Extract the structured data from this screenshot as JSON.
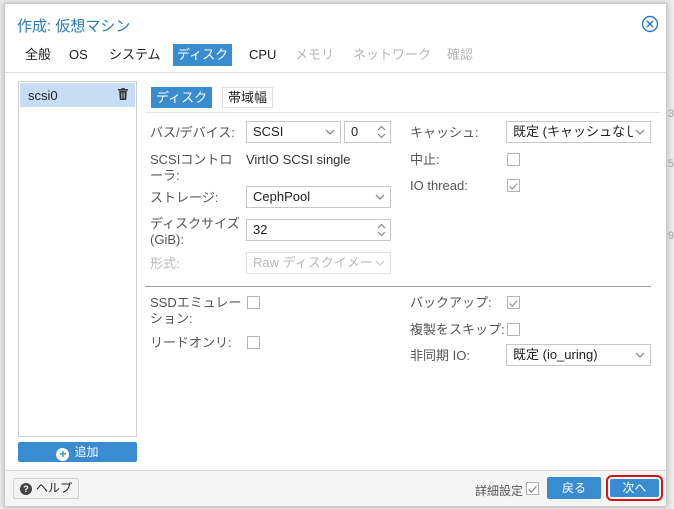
{
  "dialog": {
    "title": "作成: 仮想マシン"
  },
  "tabs": [
    {
      "label": "全般",
      "state": "normal"
    },
    {
      "label": "OS",
      "state": "normal"
    },
    {
      "label": "システム",
      "state": "normal"
    },
    {
      "label": "ディスク",
      "state": "active"
    },
    {
      "label": "CPU",
      "state": "normal"
    },
    {
      "label": "メモリ",
      "state": "disabled"
    },
    {
      "label": "ネットワーク",
      "state": "disabled"
    },
    {
      "label": "確認",
      "state": "disabled"
    }
  ],
  "disk_list": {
    "items": [
      {
        "label": "scsi0",
        "selected": true
      }
    ],
    "add_label": "追加"
  },
  "subtabs": {
    "disk": "ディスク",
    "bandwidth": "帯域幅"
  },
  "form": {
    "bus_label": "バス/デバイス:",
    "bus_value": "SCSI",
    "device_index": "0",
    "controller_label": "SCSIコントローラ:",
    "controller_value": "VirtIO SCSI single",
    "storage_label": "ストレージ:",
    "storage_value": "CephPool",
    "size_label": "ディスクサイズ (GiB):",
    "size_value": "32",
    "format_label": "形式:",
    "format_value": "Raw ディスクイメージ",
    "cache_label": "キャッシュ:",
    "cache_value": "既定 (キャッシュなし)",
    "discard_label": "中止:",
    "discard_checked": false,
    "iothread_label": "IO thread:",
    "iothread_checked": true,
    "ssd_label": "SSDエミュレーション:",
    "ssd_checked": false,
    "readonly_label": "リードオンリ:",
    "readonly_checked": false,
    "backup_label": "バックアップ:",
    "backup_checked": true,
    "skip_replication_label": "複製をスキップ:",
    "skip_replication_checked": false,
    "async_io_label": "非同期 IO:",
    "async_io_value": "既定 (io_uring)"
  },
  "footer": {
    "help_label": "ヘルプ",
    "advanced_label": "詳細設定",
    "advanced_checked": true,
    "back_label": "戻る",
    "next_label": "次へ"
  },
  "colors": {
    "accent": "#3a8cd0",
    "highlight_ring": "#d3141a",
    "selected_row": "#c6ddf3"
  }
}
